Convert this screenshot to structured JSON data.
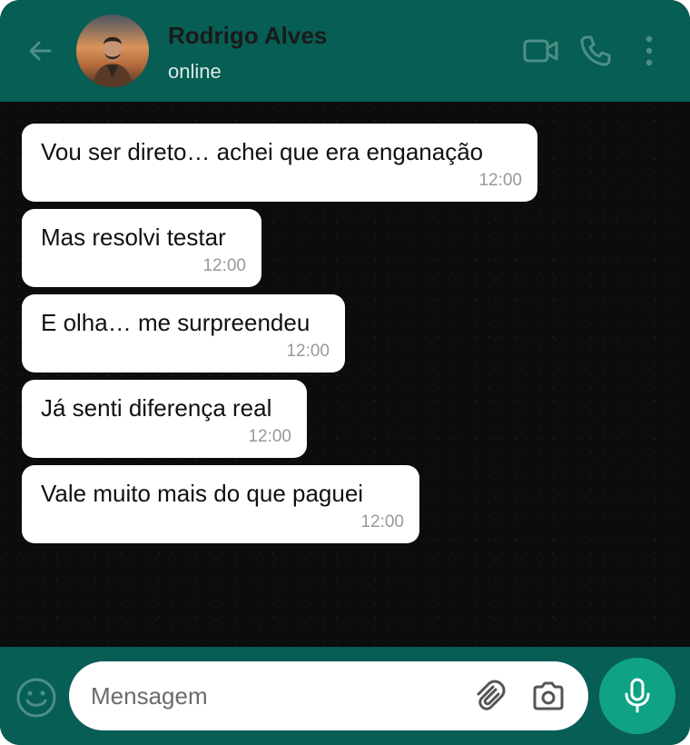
{
  "header": {
    "contact_name": "Rodrigo Alves",
    "status": "online"
  },
  "messages": [
    {
      "text": "Vou ser direto… achei que era enganação",
      "time": "12:00"
    },
    {
      "text": "Mas resolvi testar",
      "time": "12:00"
    },
    {
      "text": "E olha… me surpreendeu",
      "time": "12:00"
    },
    {
      "text": "Já senti diferença real",
      "time": "12:00"
    },
    {
      "text": "Vale muito mais do que paguei",
      "time": "12:00"
    }
  ],
  "composer": {
    "placeholder": "Mensagem"
  },
  "icons": {
    "back": "arrow-left-icon",
    "video": "video-camera-icon",
    "call": "phone-icon",
    "menu": "more-vertical-icon",
    "emoji": "emoji-icon",
    "attach": "paperclip-icon",
    "camera": "camera-icon",
    "mic": "microphone-icon"
  },
  "colors": {
    "header_bg": "#075e54",
    "chat_bg": "#0c0c0c",
    "bubble_bg": "#ffffff",
    "mic_button": "#0fa383"
  }
}
